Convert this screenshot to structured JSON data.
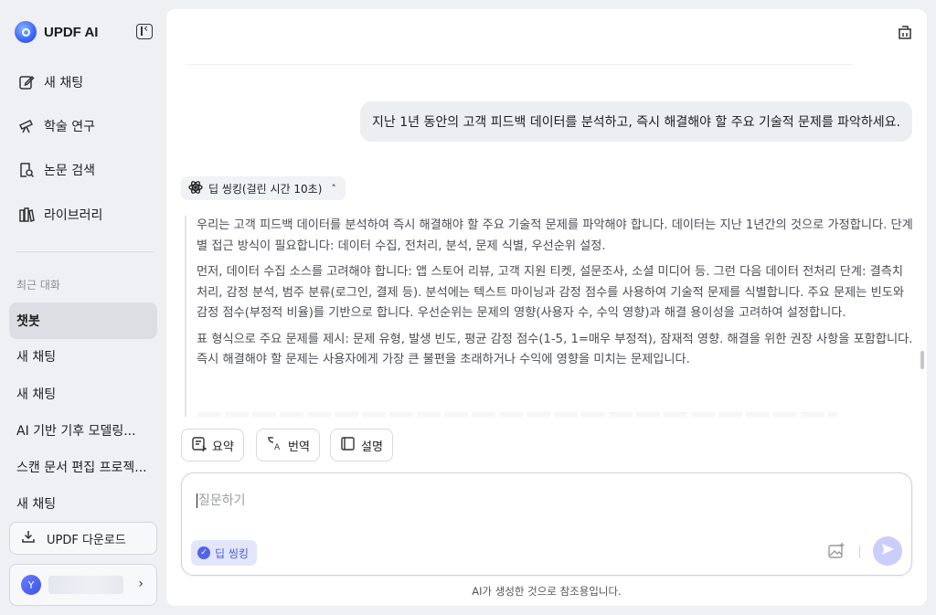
{
  "app": {
    "name": "UPDF AI"
  },
  "sidebar": {
    "nav": [
      {
        "label": "새 채팅",
        "icon": "edit-icon"
      },
      {
        "label": "학술 연구",
        "icon": "telescope-icon"
      },
      {
        "label": "논문 검색",
        "icon": "search-doc-icon"
      },
      {
        "label": "라이브러리",
        "icon": "library-icon"
      }
    ],
    "recent_label": "최근 대화",
    "recent": [
      {
        "label": "챗봇",
        "active": true
      },
      {
        "label": "새 채팅"
      },
      {
        "label": "새 채팅"
      },
      {
        "label": "AI 기반 기후 모델링..."
      },
      {
        "label": "스캔 문서 편집 프로젝..."
      },
      {
        "label": "새 채팅"
      }
    ],
    "download_label": "UPDF 다운로드",
    "user": {
      "avatar_initial": "Y"
    }
  },
  "chat": {
    "user_message": "지난 1년 동안의 고객 피드백 데이터를 분석하고, 즉시 해결해야 할 주요 기술적 문제를 파악하세요.",
    "thinking_toggle": "딥 씽킹(걸린 시간 10초)",
    "thinking_paragraphs": [
      "우리는 고객 피드백 데이터를 분석하여 즉시 해결해야 할 주요 기술적 문제를 파악해야 합니다. 데이터는 지난 1년간의 것으로 가정합니다. 단계별 접근 방식이 필요합니다: 데이터 수집, 전처리, 분석, 문제 식별, 우선순위 설정.",
      "먼저, 데이터 수집 소스를 고려해야 합니다: 앱 스토어 리뷰, 고객 지원 티켓, 설문조사, 소셜 미디어 등. 그런 다음 데이터 전처리 단계: 결측치 처리, 감정 분석, 범주 분류(로그인, 결제 등). 분석에는 텍스트 마이닝과 감정 점수를 사용하여 기술적 문제를 식별합니다. 주요 문제는 빈도와 감정 점수(부정적 비율)를 기반으로 합니다. 우선순위는 문제의 영향(사용자 수, 수익 영향)과 해결 용이성을 고려하여 설정합니다.",
      "표 형식으로 주요 문제를 제시: 문제 유형, 발생 빈도, 평균 감정 점수(1-5, 1=매우 부정적), 잠재적 영향. 해결을 위한 권장 사항을 포함합니다. 즉시 해결해야 할 문제는 사용자에게 가장 큰 불편을 초래하거나 수익에 영향을 미치는 문제입니다."
    ]
  },
  "quick_actions": [
    {
      "label": "요약",
      "icon": "summary-icon"
    },
    {
      "label": "번역",
      "icon": "translate-icon"
    },
    {
      "label": "설명",
      "icon": "book-icon"
    }
  ],
  "composer": {
    "placeholder": "질문하기",
    "deep_thinking_label": "딥 씽킹"
  },
  "disclaimer": "AI가 생성한 것으로 참조용입니다.",
  "colors": {
    "accent": "#5164e8",
    "send_disabled": "#c9cefa"
  }
}
